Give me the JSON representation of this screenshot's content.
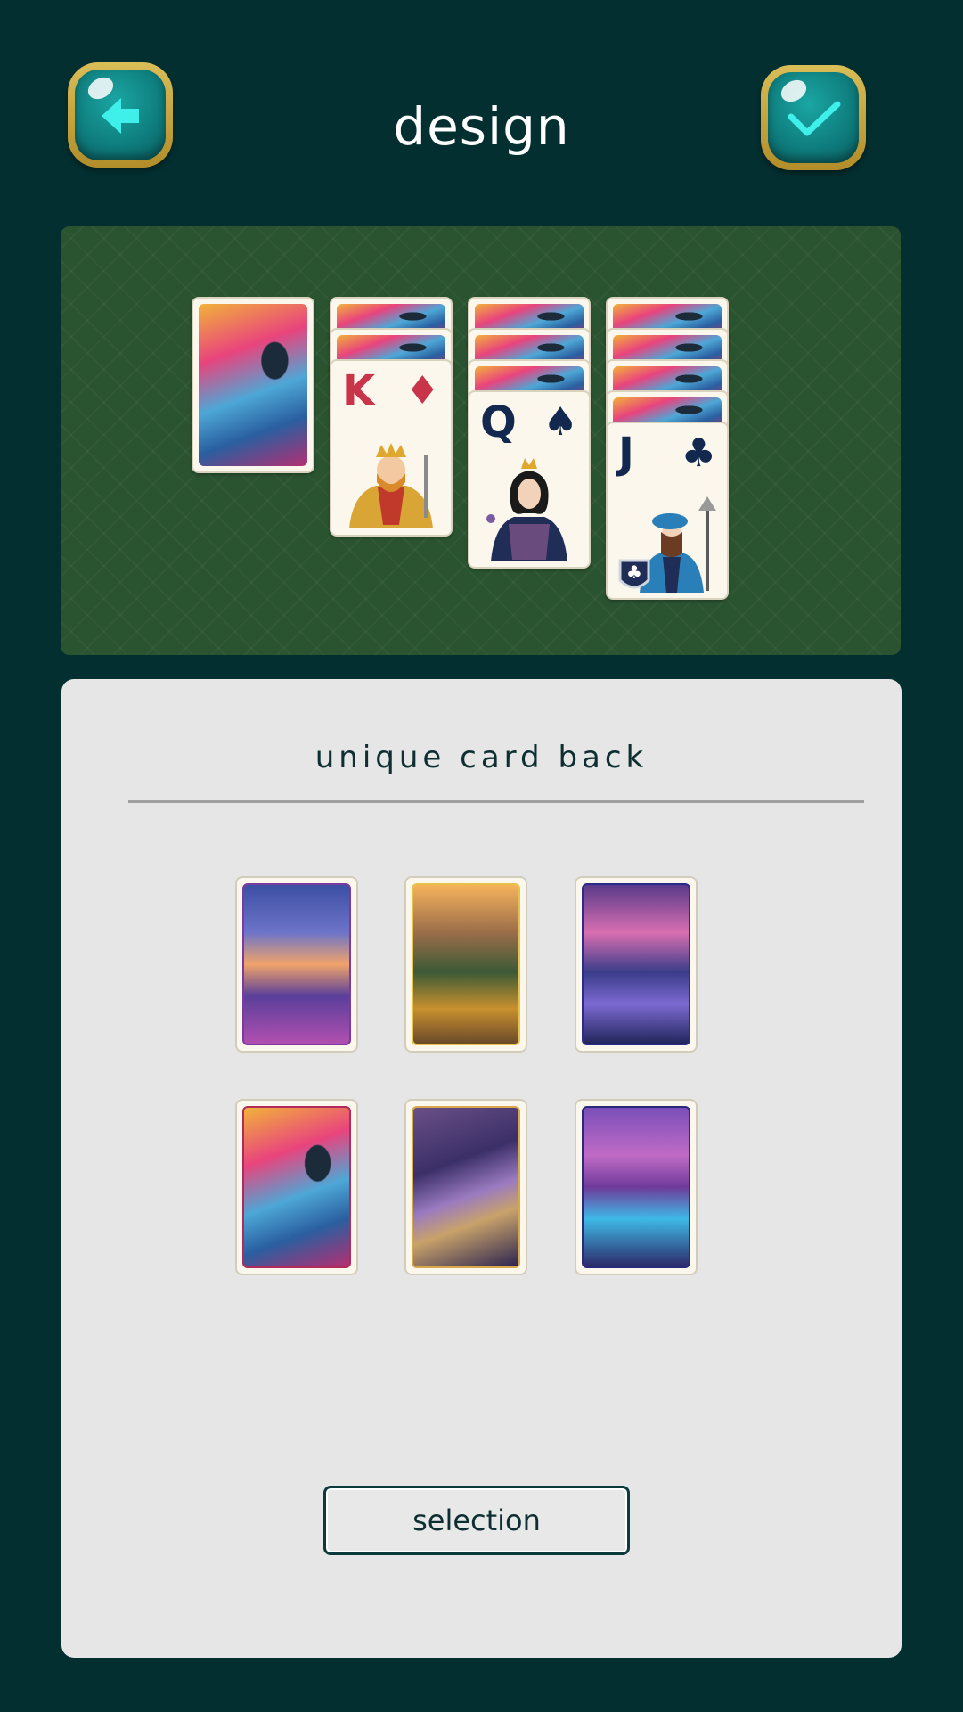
{
  "header": {
    "title": "design",
    "back_icon": "arrow-left-icon",
    "confirm_icon": "checkmark-icon"
  },
  "preview": {
    "columns": [
      {
        "face_down": 1,
        "top": null
      },
      {
        "face_down": 2,
        "top": {
          "rank": "K",
          "suit": "♦",
          "figure": "king-icon"
        }
      },
      {
        "face_down": 3,
        "top": {
          "rank": "Q",
          "suit": "♠",
          "figure": "queen-icon"
        }
      },
      {
        "face_down": 4,
        "top": {
          "rank": "J",
          "suit": "♣",
          "figure": "jack-icon"
        }
      }
    ],
    "table_color": "#2a5330"
  },
  "panel": {
    "title": "unique card back",
    "options": [
      {
        "name": "tropical-beach-sunset"
      },
      {
        "name": "golden-valley-stream"
      },
      {
        "name": "purple-rocky-coast"
      },
      {
        "name": "pink-pixel-tree"
      },
      {
        "name": "purple-mountain"
      },
      {
        "name": "glowing-canyon-river"
      }
    ],
    "button_label": "selection"
  },
  "colors": {
    "background": "#032f30",
    "panel": "#e6e6e6",
    "button_border": "#0d3a3b",
    "gold_frame": "#c9a63b",
    "teal_button": "#0f7f7f"
  }
}
